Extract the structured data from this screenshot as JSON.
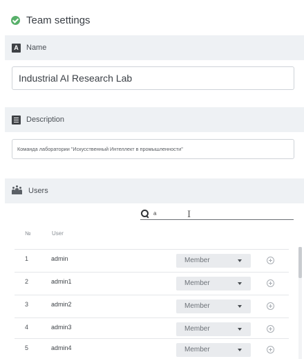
{
  "panel": {
    "title": "Team settings",
    "status_color": "#58b06a"
  },
  "sections": {
    "name": {
      "label": "Name",
      "icon": "a-letter-icon",
      "badge_letter": "A",
      "value": "Industrial AI Research Lab"
    },
    "description": {
      "label": "Description",
      "icon": "document-icon",
      "value": "Команда лаборатории \"Искусственный Интеллект в промышленности\""
    },
    "users": {
      "label": "Users",
      "icon": "users-icon"
    }
  },
  "search": {
    "icon": "search-icon",
    "value": "a"
  },
  "table": {
    "columns": [
      "№",
      "User"
    ],
    "rows": [
      {
        "num": "1",
        "user": "admin",
        "role": "Member"
      },
      {
        "num": "2",
        "user": "admin1",
        "role": "Member"
      },
      {
        "num": "3",
        "user": "admin2",
        "role": "Member"
      },
      {
        "num": "4",
        "user": "admin3",
        "role": "Member"
      },
      {
        "num": "5",
        "user": "admin4",
        "role": "Member"
      }
    ]
  }
}
